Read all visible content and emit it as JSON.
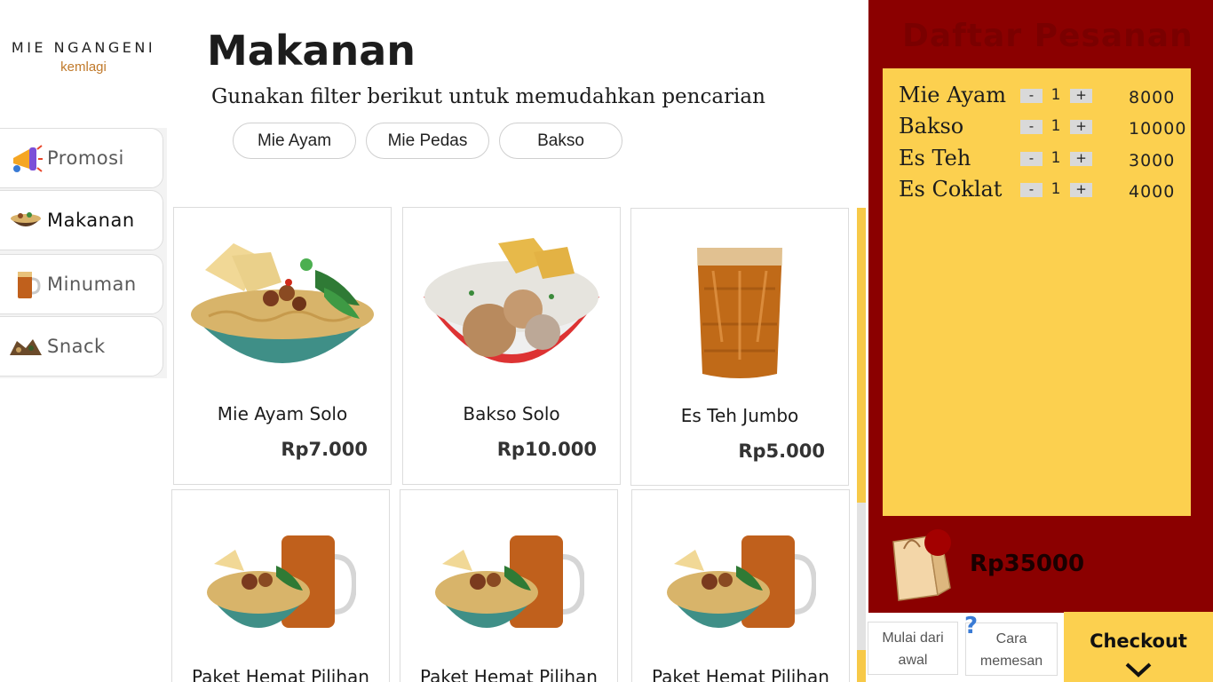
{
  "brand": {
    "name": "MIE NGANGENI",
    "subtitle": "kemlagi"
  },
  "sidebar": {
    "items": [
      {
        "label": "Promosi",
        "icon": "megaphone-icon"
      },
      {
        "label": "Makanan",
        "icon": "noodle-bowl-icon",
        "active": true
      },
      {
        "label": "Minuman",
        "icon": "iced-tea-icon"
      },
      {
        "label": "Snack",
        "icon": "snack-icon"
      }
    ]
  },
  "main": {
    "title": "Makanan",
    "subtitle": "Gunakan filter berikut untuk memudahkan pencarian",
    "filters": [
      "Mie Ayam",
      "Mie Pedas",
      "Bakso"
    ],
    "products": [
      {
        "name": "Mie Ayam Solo",
        "price": "Rp7.000",
        "image": "mie-ayam-bowl"
      },
      {
        "name": "Bakso Solo",
        "price": "Rp10.000",
        "image": "bakso-bowl"
      },
      {
        "name": "Es Teh Jumbo",
        "price": "Rp5.000",
        "image": "iced-tea-glass"
      },
      {
        "name": "Paket Hemat Pilihan",
        "image": "combo-meal"
      },
      {
        "name": "Paket Hemat Pilihan",
        "image": "combo-meal"
      },
      {
        "name": "Paket Hemat Pilihan",
        "image": "combo-meal"
      }
    ]
  },
  "order": {
    "title": "Daftar Pesanan",
    "minus_label": "-",
    "plus_label": "+",
    "items": [
      {
        "name": "Mie Ayam",
        "qty": "1",
        "price": "8000"
      },
      {
        "name": "Bakso",
        "qty": "1",
        "price": "10000"
      },
      {
        "name": "Es Teh",
        "qty": "1",
        "price": "3000"
      },
      {
        "name": "Es Coklat",
        "qty": "1",
        "price": "4000"
      }
    ],
    "total": "Rp35000"
  },
  "actions": {
    "restart_line1": "Mulai dari",
    "restart_line2": "awal",
    "howto_line1": "Cara",
    "howto_line2": "memesan",
    "howto_badge": "?",
    "checkout": "Checkout"
  },
  "colors": {
    "panel_red": "#8b0000",
    "panel_yellow": "#fcd04f",
    "brand_orange": "#c0792a"
  }
}
